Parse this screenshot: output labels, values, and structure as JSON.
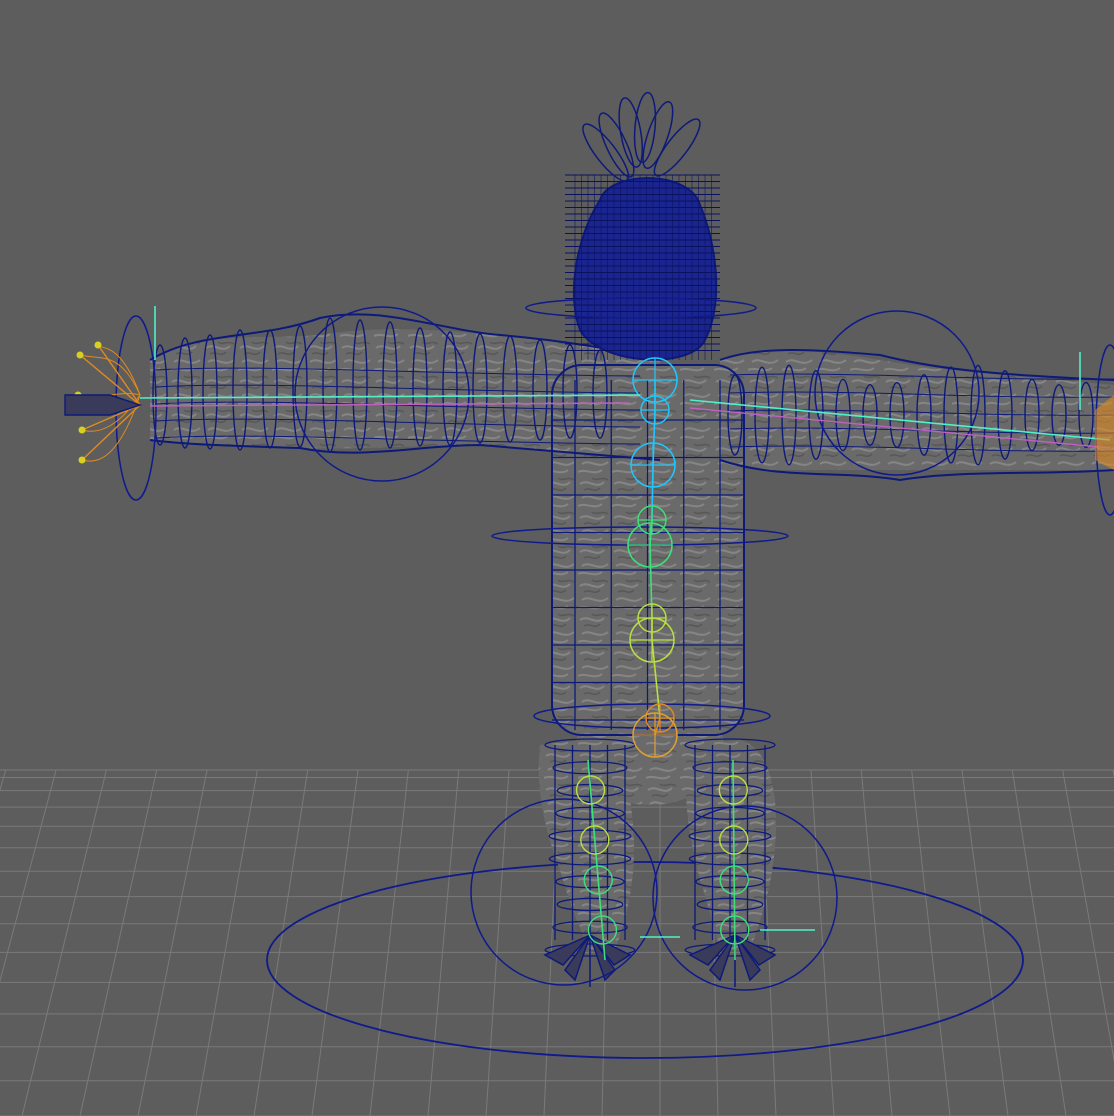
{
  "viewport": {
    "panel": "perspective-viewport",
    "background_color": "#5d5d5d",
    "grid_color": "#7a7a7a",
    "wireframe_color": "#0d1a7a",
    "mesh_fill_color": "#6b6b6b",
    "control_curve_color": "#0f1a8c",
    "joint_colors": [
      "#1ec8ff",
      "#3ee07a",
      "#b8e040",
      "#e0a030",
      "#e08a20"
    ],
    "axis_highlight_color": "#50f0c8",
    "ik_line_color": "#c060c0",
    "hand_joint_color": "#e08a20",
    "finger_tip_color": "#d8d020"
  }
}
